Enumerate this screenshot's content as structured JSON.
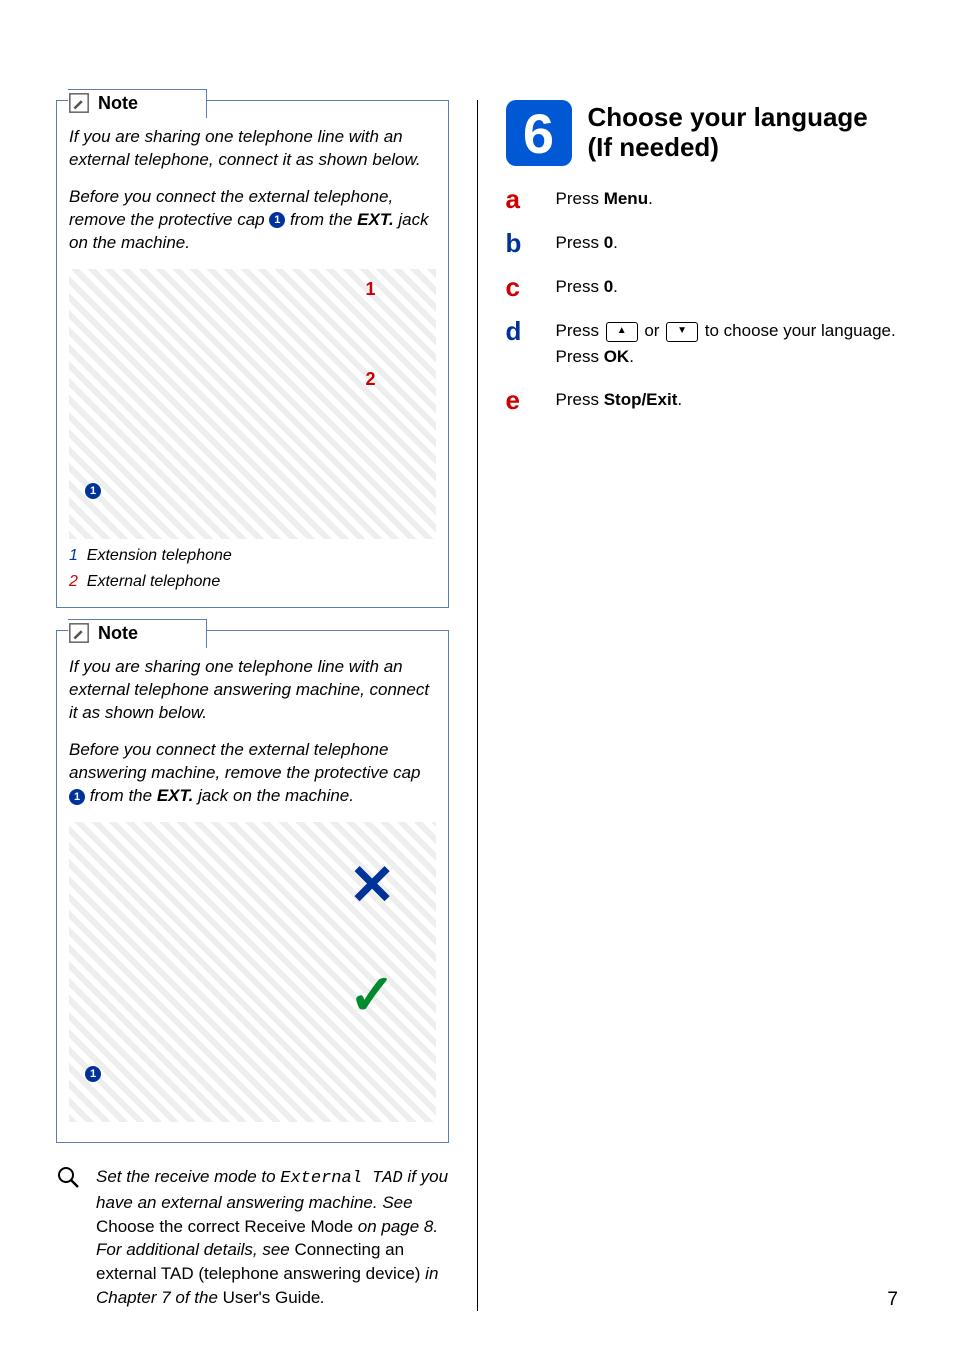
{
  "page_number": "7",
  "note1": {
    "label": "Note",
    "para1_a": "If you are sharing one telephone line with an external telephone, connect it as shown below.",
    "para2_a": "Before you connect the external telephone, remove the protective cap ",
    "para2_b": " from the ",
    "para2_c": "EXT.",
    "para2_d": " jack on the machine.",
    "cap_num": "1",
    "legend1_num": "1",
    "legend1_txt": "Extension telephone",
    "legend2_num": "2",
    "legend2_txt": "External telephone",
    "diag_label1": "1",
    "diag_label2": "2"
  },
  "note2": {
    "label": "Note",
    "para1_a": "If you are sharing one telephone line with an external telephone answering machine, connect it as shown below.",
    "para2_a": "Before you connect the external telephone answering machine, remove the protective cap ",
    "para2_b": " from the ",
    "para2_c": "EXT.",
    "para2_d": " jack on the machine.",
    "cap_num": "1",
    "cross": "✕",
    "check": "✓"
  },
  "tip": {
    "t1": "Set the receive mode to ",
    "t_mono": "External TAD",
    "t2": " if you have an external answering machine. See ",
    "t_roman1": "Choose the correct Receive Mode",
    "t3": " on page 8. For additional details, see ",
    "t_roman2": "Connecting an external TAD (telephone answering device)",
    "t4": " in Chapter 7 of the ",
    "t_roman3": "User's Guide",
    "t5": "."
  },
  "step": {
    "number": "6",
    "title_line1": "Choose your language",
    "title_line2": "(If needed)"
  },
  "substeps": {
    "a_letter": "a",
    "a_pre": "Press ",
    "a_bold": "Menu",
    "a_post": ".",
    "b_letter": "b",
    "b_pre": "Press ",
    "b_bold": "0",
    "b_post": ".",
    "c_letter": "c",
    "c_pre": "Press ",
    "c_bold": "0",
    "c_post": ".",
    "d_letter": "d",
    "d_pre": "Press ",
    "d_or": " or ",
    "d_post": " to choose your language.",
    "d_line2_pre": "Press ",
    "d_line2_bold": "OK",
    "d_line2_post": ".",
    "up": "▲",
    "down": "▼",
    "e_letter": "e",
    "e_pre": "Press ",
    "e_bold": "Stop/Exit",
    "e_post": "."
  }
}
